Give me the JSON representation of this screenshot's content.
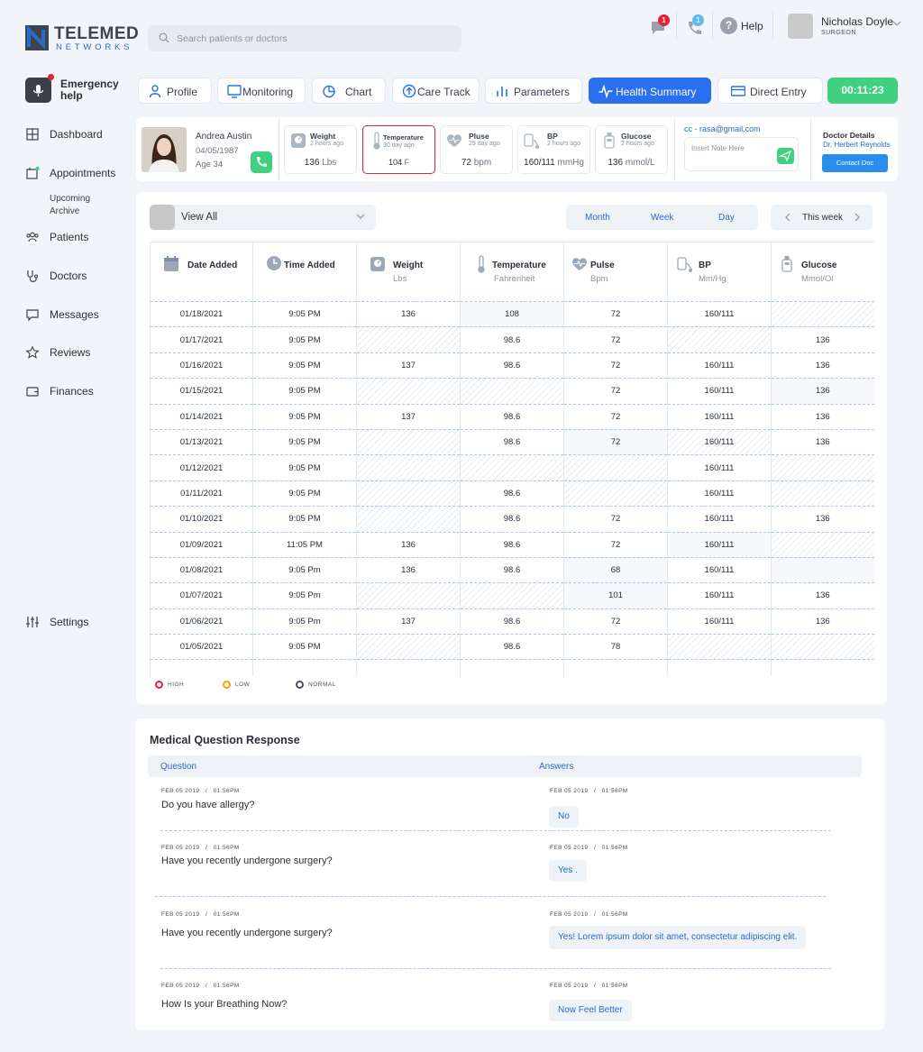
{
  "brand": {
    "name": "TELEMED",
    "sub": "NETWORKS"
  },
  "search": {
    "placeholder": "Search patients or doctors"
  },
  "header": {
    "messages_badge": "1",
    "calls_badge": "1",
    "help_label": "Help",
    "user_name": "Nicholas Doyle",
    "user_role": "SURGEON"
  },
  "sidebar": {
    "emergency_label": "Emergency help",
    "items": [
      {
        "label": "Dashboard",
        "icon": "grid-icon"
      },
      {
        "label": "Appointments",
        "icon": "calendar-icon"
      },
      {
        "label": "Patients",
        "icon": "people-icon"
      },
      {
        "label": "Doctors",
        "icon": "stethoscope-icon"
      },
      {
        "label": "Messages",
        "icon": "chat-icon"
      },
      {
        "label": "Reviews",
        "icon": "star-icon"
      },
      {
        "label": "Finances",
        "icon": "wallet-icon"
      }
    ],
    "sub_items": [
      "Upcoming",
      "Archive"
    ],
    "settings_label": "Settings"
  },
  "tabs": [
    {
      "label": "Profile",
      "icon": "user-icon"
    },
    {
      "label": "Monitoring",
      "icon": "monitor-icon"
    },
    {
      "label": "Chart",
      "icon": "pie-chart-icon"
    },
    {
      "label": "Care Track",
      "icon": "arrow-up-circle-icon"
    },
    {
      "label": "Parameters",
      "icon": "bar-chart-icon"
    },
    {
      "label": "Health Summary",
      "icon": "pulse-icon"
    },
    {
      "label": "Direct Entry",
      "icon": "card-icon"
    }
  ],
  "timer": "00:11:23",
  "patient": {
    "name": "Andrea Austin",
    "dob": "04/05/1987",
    "age": "Age 34"
  },
  "vitals": [
    {
      "title": "Weight",
      "sub": "2 hours ago",
      "value": "136",
      "unit": "Lbs"
    },
    {
      "title": "Temperature",
      "sub": "30 day ago",
      "value": "104",
      "unit": "F"
    },
    {
      "title": "Pluse",
      "sub": "25 day ago",
      "value": "72",
      "unit": "bpm"
    },
    {
      "title": "BP",
      "sub": "2 hours ago",
      "value": "160/111",
      "unit": "mmHg"
    },
    {
      "title": "Glucose",
      "sub": "2 hours ago",
      "value": "136",
      "unit": "mmol/L"
    }
  ],
  "note": {
    "cc": "cc - rasa@gmail.com",
    "placeholder": "Insert Note Here"
  },
  "doctor": {
    "title": "Doctor Details",
    "name": "Dr. Herbert Reynolds",
    "button": "Contact Doc"
  },
  "filter": {
    "view_label": "View All",
    "periods": [
      "Month",
      "Week",
      "Day"
    ],
    "week_label": "This week"
  },
  "table": {
    "columns": [
      {
        "title": "Date Added",
        "sub": "",
        "icon": "calendar-icon"
      },
      {
        "title": "Time Added",
        "sub": "",
        "icon": "clock-icon"
      },
      {
        "title": "Weight",
        "sub": "Lbs",
        "icon": "scale-icon"
      },
      {
        "title": "Temperature",
        "sub": "Fahrenheit",
        "icon": "thermometer-icon"
      },
      {
        "title": "Pulse",
        "sub": "Bpm",
        "icon": "heart-pulse-icon"
      },
      {
        "title": "BP",
        "sub": "Mm/Hg",
        "icon": "bp-cuff-icon"
      },
      {
        "title": "Glucose",
        "sub": "Mmol/Ol",
        "icon": "glucose-meter-icon"
      }
    ],
    "rows": [
      [
        "01/18/2021",
        "9:05 PM",
        "136",
        "108",
        "72",
        "160/111",
        ""
      ],
      [
        "01/17/2021",
        "9:05 PM",
        "",
        "98.6",
        "72",
        "",
        "136"
      ],
      [
        "01/16/2021",
        "9:05 PM",
        "137",
        "98.6",
        "72",
        "160/111",
        "136"
      ],
      [
        "01/15/2021",
        "9:05 PM",
        "",
        "",
        "72",
        "160/111",
        "136"
      ],
      [
        "01/14/2021",
        "9:05 PM",
        "137",
        "98.6",
        "72",
        "160/111",
        "136"
      ],
      [
        "01/13/2021",
        "9:05 PM",
        "",
        "98.6",
        "72",
        "160/111",
        "136"
      ],
      [
        "01/12/2021",
        "9:05 PM",
        "",
        "",
        "",
        "160/111",
        ""
      ],
      [
        "01/11/2021",
        "9:05 PM",
        "",
        "98.6",
        "",
        "160/111",
        ""
      ],
      [
        "01/10/2021",
        "9:05 PM",
        "",
        "98.6",
        "72",
        "160/111",
        "136"
      ],
      [
        "01/09/2021",
        "11:05 PM",
        "136",
        "98.6",
        "72",
        "160/111",
        ""
      ],
      [
        "01/08/2021",
        "9:05 Pm",
        "136",
        "98.6",
        "68",
        "160/111",
        ""
      ],
      [
        "01/07/2021",
        "9:05 Pm",
        "",
        "",
        "101",
        "160/111",
        "136"
      ],
      [
        "01/06/2021",
        "9:05 Pm",
        "137",
        "98.6",
        "72",
        "160/111",
        "136"
      ],
      [
        "01/05/2021",
        "9:05 PM",
        "",
        "98.6",
        "78",
        "",
        ""
      ]
    ],
    "flags": {
      "0-3": "high",
      "3-5": "high",
      "3-6": "low",
      "4-5": "high",
      "8-5": "low",
      "10-4": "low",
      "11-4": "high",
      "12-5": "high"
    },
    "hatched": [
      "0-6",
      "1-2",
      "1-5",
      "3-2",
      "3-3",
      "5-2",
      "5-5",
      "6-2",
      "6-3",
      "6-4",
      "6-6",
      "7-2",
      "7-4",
      "7-6",
      "8-2",
      "9-6",
      "11-2",
      "11-3",
      "13-2",
      "13-5",
      "13-6"
    ],
    "highlighted": [
      "0-3",
      "3-6",
      "10-4",
      "10-6",
      "11-4",
      "5-4",
      "9-5"
    ]
  },
  "legend": [
    {
      "label": "HIGH",
      "color": "#e2233a"
    },
    {
      "label": "LOW",
      "color": "#f0a40f"
    },
    {
      "label": "NORMAL",
      "color": "#4a5060"
    }
  ],
  "questions": {
    "title": "Medical Question Response",
    "head_question": "Question",
    "head_answer": "Answers",
    "items": [
      {
        "date": "FEB 05 2019",
        "time": "01:56PM",
        "question": "Do you have allergy?",
        "a_date": "FEB 05 2019",
        "a_time": "01:56PM",
        "answer": "No"
      },
      {
        "date": "FEB 05 2019",
        "time": "01:56PM",
        "question": "Have you recently undergone surgery?",
        "a_date": "FEB 05 2019",
        "a_time": "01:56PM",
        "answer": "Yes ."
      },
      {
        "date": "FEB 05 2019",
        "time": "01:56PM",
        "question": "Have you recently undergone surgery?",
        "a_date": "FEB 05 2019",
        "a_time": "01:56PM",
        "answer": "Yes! Lorem ipsum dolor sit amet, consectetur adipiscing elit."
      },
      {
        "date": "FEB 05 2019",
        "time": "01:56PM",
        "question": "How Is your Breathing Now?",
        "a_date": "FEB 05 2019",
        "a_time": "01:56PM",
        "answer": "Now Feel Better"
      }
    ]
  },
  "colors": {
    "accent": "#2a6ff0",
    "success": "#3fd17f",
    "high": "#e2233a",
    "low": "#f0a40f"
  }
}
